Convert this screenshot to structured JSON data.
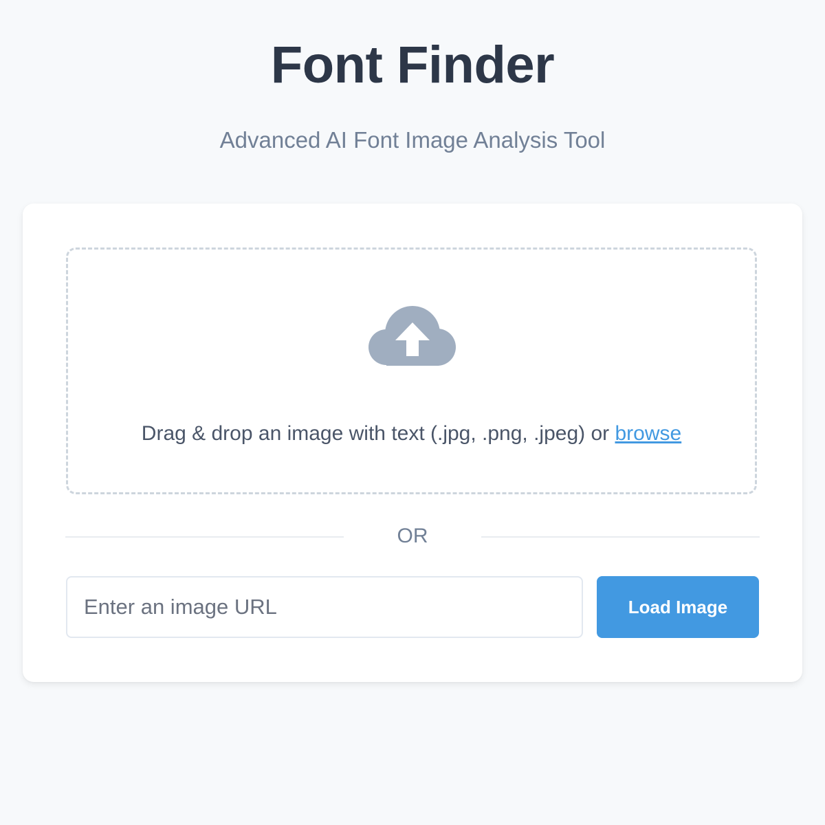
{
  "header": {
    "title": "Font Finder",
    "subtitle": "Advanced AI Font Image Analysis Tool"
  },
  "upload": {
    "icon": "cloud-upload-icon",
    "instructions": "Drag & drop an image with text (.jpg, .png, .jpeg) or ",
    "browse_label": "browse"
  },
  "divider": {
    "label": "OR"
  },
  "url_form": {
    "value": "",
    "placeholder": "Enter an image URL",
    "button_label": "Load Image"
  },
  "colors": {
    "accent": "#4299e1",
    "title": "#2d3748",
    "subtitle": "#718096",
    "icon": "#a0aec0",
    "background": "#f7f9fb"
  }
}
